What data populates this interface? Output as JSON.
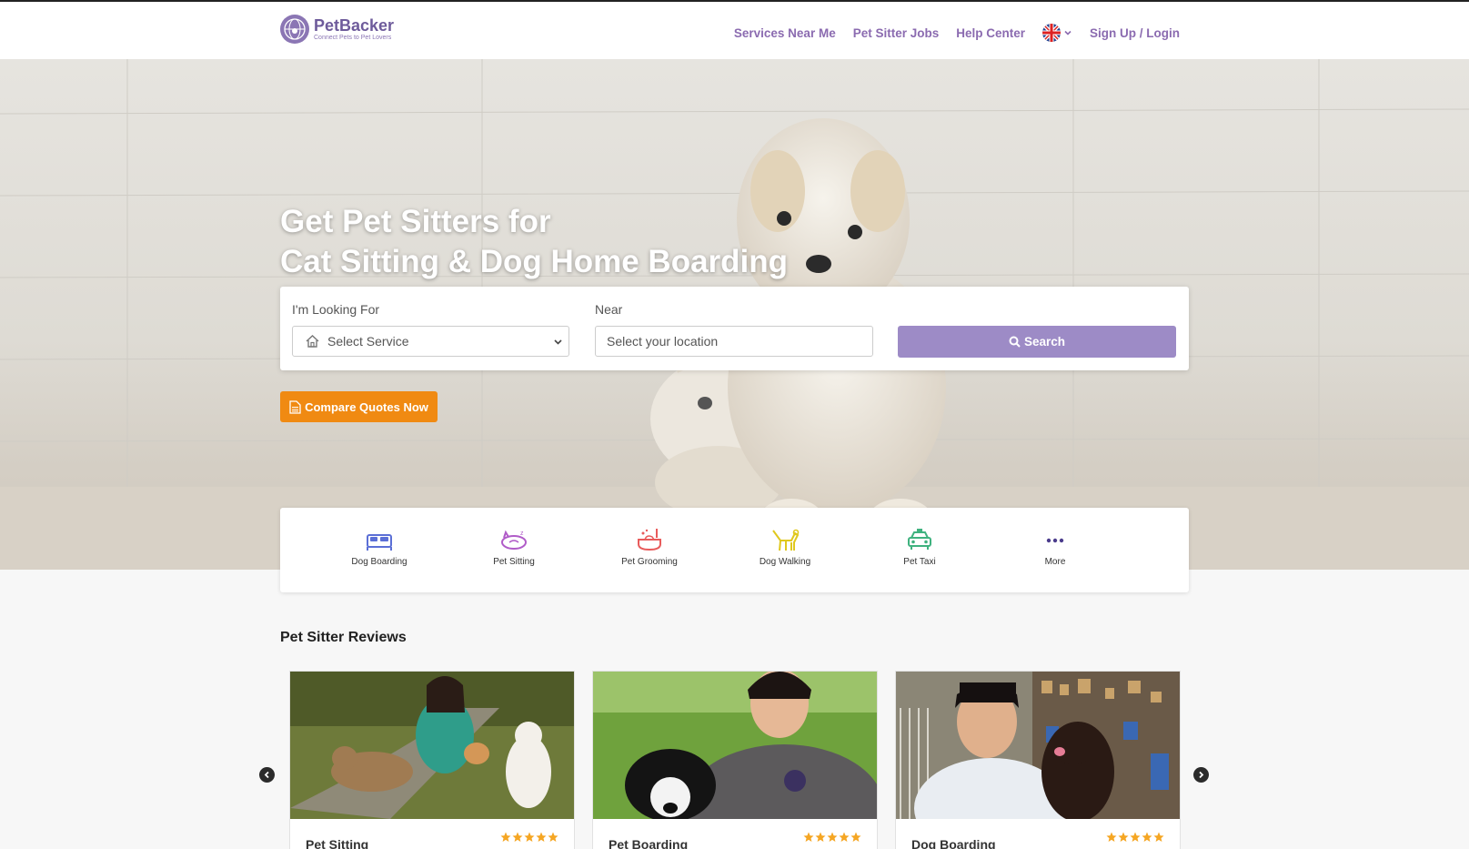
{
  "brand": {
    "name": "PetBacker",
    "tagline": "Connect Pets to Pet Lovers"
  },
  "nav": {
    "services": "Services Near Me",
    "jobs": "Pet Sitter Jobs",
    "help": "Help Center",
    "auth": "Sign Up / Login"
  },
  "hero": {
    "title_line1": "Get Pet Sitters for",
    "title_line2": "Cat Sitting & Dog Home Boarding"
  },
  "search": {
    "looking_label": "I'm Looking For",
    "service_value": "Select Service",
    "near_label": "Near",
    "location_placeholder": "Select your location",
    "button": "Search"
  },
  "compare_button": "Compare Quotes Now",
  "services": [
    {
      "label": "Dog Boarding",
      "icon": "bed-icon",
      "color": "#5b6fd6"
    },
    {
      "label": "Pet Sitting",
      "icon": "cat-sleeping-icon",
      "color": "#b05cc8"
    },
    {
      "label": "Pet Grooming",
      "icon": "bathtub-icon",
      "color": "#e85b5b"
    },
    {
      "label": "Dog Walking",
      "icon": "dog-icon",
      "color": "#e0c81d"
    },
    {
      "label": "Pet Taxi",
      "icon": "taxi-icon",
      "color": "#3fb27f"
    },
    {
      "label": "More",
      "icon": "more-dots-icon",
      "color": "#4b3c8c"
    }
  ],
  "reviews": {
    "title": "Pet Sitter Reviews",
    "cards": [
      {
        "title": "Pet Sitting",
        "rating": 5
      },
      {
        "title": "Pet Boarding",
        "rating": 5
      },
      {
        "title": "Dog Boarding",
        "rating": 5
      }
    ]
  },
  "colors": {
    "brand_purple": "#8b6bb0",
    "search_button": "#9d8bc6",
    "compare_button": "#f08a12",
    "star": "#f5a623"
  }
}
